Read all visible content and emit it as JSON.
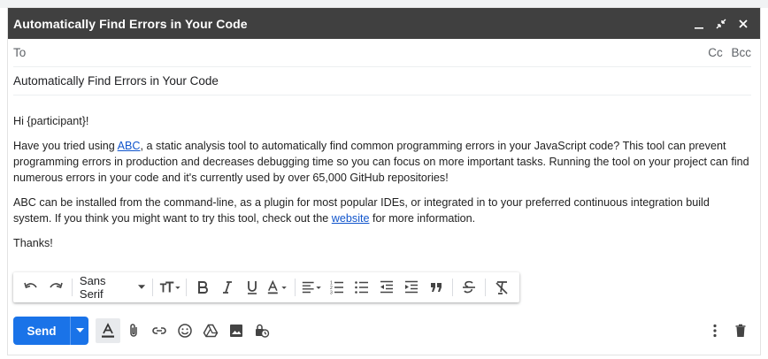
{
  "window": {
    "title": "Automatically Find Errors in Your Code"
  },
  "compose": {
    "to_label": "To",
    "cc_label": "Cc",
    "bcc_label": "Bcc",
    "subject": "Automatically Find Errors in Your Code"
  },
  "message": {
    "greeting": "Hi {participant}!",
    "p1_before_link": "Have you tried using ",
    "p1_link": "ABC",
    "p1_after_link": ", a static analysis tool to automatically find common programming errors in your JavaScript code?  This tool can prevent programming errors in production and decreases debugging time so you can focus on more important tasks. Running the tool on your project can find numerous errors in your code and it's currently used by over 65,000 GitHub repositories!",
    "p2_before_link": "ABC can be installed from the command-line, as a plugin for most popular IDEs, or integrated in to your preferred continuous integration build system. If you think you might want to try this tool, check out the ",
    "p2_link": "website",
    "p2_after_link": " for more information.",
    "closing": "Thanks!"
  },
  "toolbar": {
    "font_family": "Sans Serif"
  },
  "actions": {
    "send_label": "Send"
  },
  "colors": {
    "titlebar": "#404040",
    "send": "#1a73e8",
    "link": "#1155cc"
  }
}
